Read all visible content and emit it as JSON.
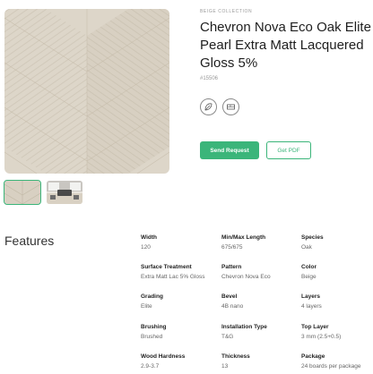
{
  "product": {
    "collection": "BEIGE COLLECTION",
    "title": "Chevron Nova Eco Oak Elite Pearl Extra Matt Lacquered Gloss 5%",
    "sku": "#15506"
  },
  "feature_icons": [
    "oak-leaf-icon",
    "floor-plank-icon"
  ],
  "actions": {
    "send_request": "Send Request",
    "get_pdf": "Get PDF"
  },
  "features": {
    "heading": "Features",
    "specs": [
      {
        "label": "Width",
        "value": "120"
      },
      {
        "label": "Min/Max Length",
        "value": "675/675"
      },
      {
        "label": "Species",
        "value": "Oak"
      },
      {
        "label": "Surface Treatment",
        "value": "Extra Matt Lac 5% Gloss"
      },
      {
        "label": "Pattern",
        "value": "Chevron Nova Eco"
      },
      {
        "label": "Color",
        "value": "Beige"
      },
      {
        "label": "Grading",
        "value": "Elite"
      },
      {
        "label": "Bevel",
        "value": "4B nano"
      },
      {
        "label": "Layers",
        "value": "4 layers"
      },
      {
        "label": "Brushing",
        "value": "Brushed"
      },
      {
        "label": "Installation Type",
        "value": "T&G"
      },
      {
        "label": "Top Layer",
        "value": "3 mm (2.5+0.5)"
      },
      {
        "label": "Wood Hardness",
        "value": "2.9-3.7"
      },
      {
        "label": "Thickness",
        "value": "13"
      },
      {
        "label": "Package",
        "value": "24 boards per package"
      }
    ]
  },
  "colors": {
    "accent": "#3bb57a",
    "wood_light": "#ddd6c9",
    "wood_dark": "#c9c0b0"
  }
}
